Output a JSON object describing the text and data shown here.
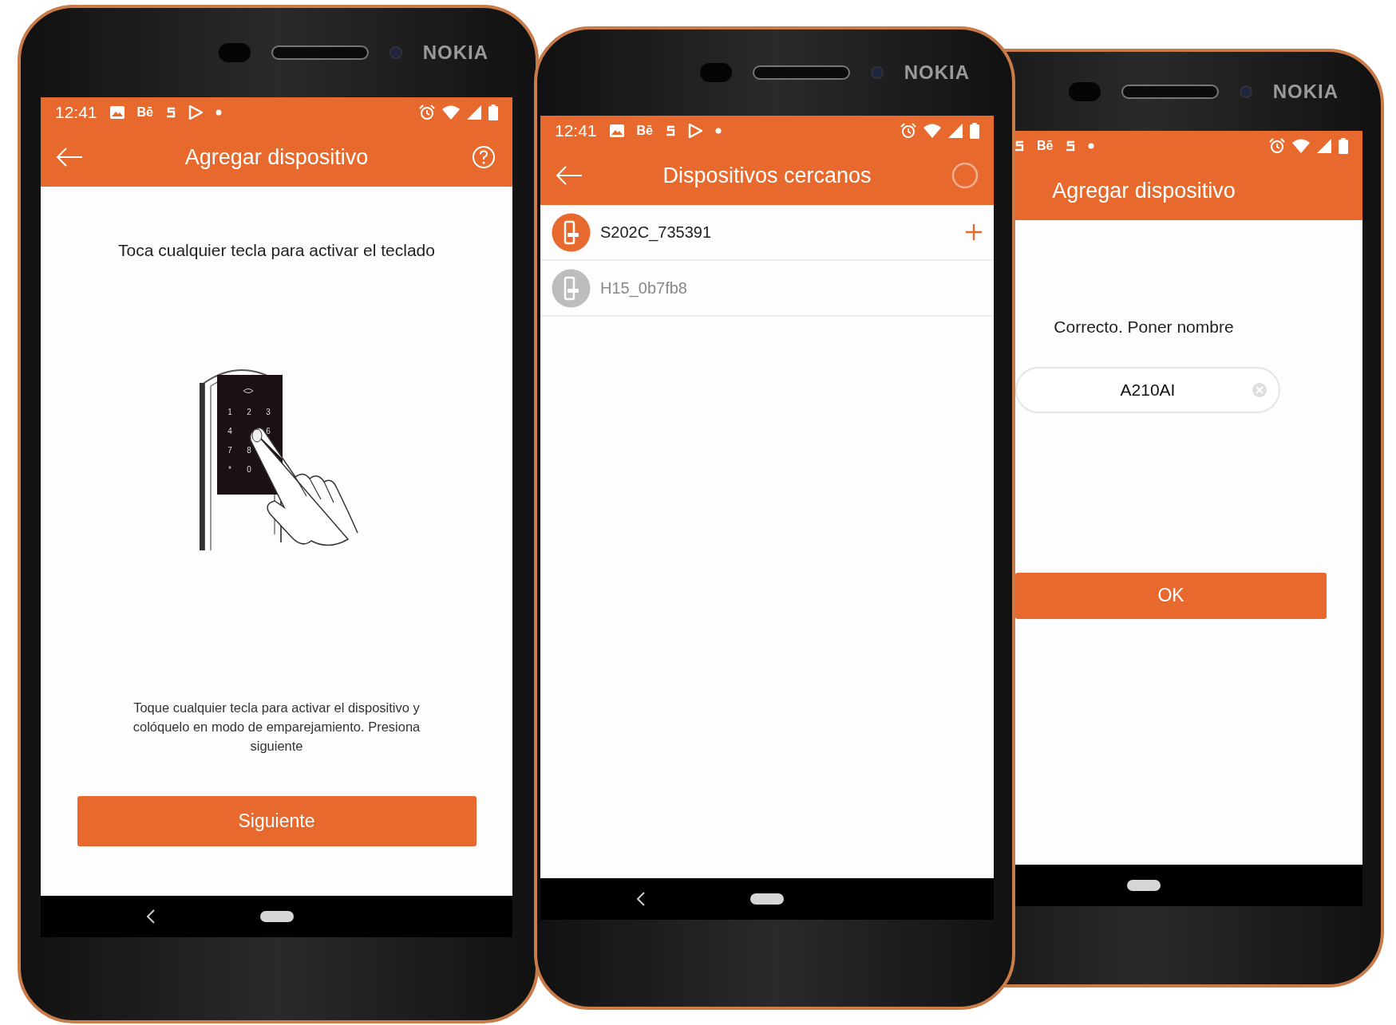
{
  "phones": [
    {
      "brand": "NOKIA",
      "status_bar": [
        {
          "kind": "time",
          "text": "12:41"
        },
        {
          "kind": "image"
        },
        {
          "kind": "text",
          "text": "Bē"
        },
        {
          "kind": "s"
        },
        {
          "kind": "play"
        },
        {
          "kind": "dot"
        }
      ],
      "toolbar": {
        "title": "Agregar dispositivo",
        "back_button": true,
        "help_button": true,
        "loading_indicator": false
      },
      "screen": {
        "kind": "instructions",
        "heading": "Toca cualquier tecla para activar el teclado",
        "keypad_keys": [
          "1",
          "2",
          "3",
          "4",
          "6",
          "7",
          "8",
          "*",
          "0"
        ],
        "description": "Toque cualquier tecla para activar el dispositivo y colóquelo en modo de emparejamiento. Presiona siguiente",
        "button": "Siguiente"
      },
      "nav_back": true
    },
    {
      "brand": "NOKIA",
      "status_bar": [
        {
          "kind": "time",
          "text": "12:41"
        },
        {
          "kind": "image"
        },
        {
          "kind": "text",
          "text": "Bē"
        },
        {
          "kind": "s"
        },
        {
          "kind": "play"
        },
        {
          "kind": "dot"
        }
      ],
      "toolbar": {
        "title": "Dispositivos cercanos",
        "back_button": true,
        "help_button": false,
        "loading_indicator": true
      },
      "screen": {
        "kind": "device_list",
        "rows": [
          {
            "name": "S202C_735391",
            "available": true
          },
          {
            "name": "H15_0b7fb8",
            "available": false
          }
        ]
      },
      "nav_back": true
    },
    {
      "brand": "NOKIA",
      "status_bar": [
        {
          "kind": "s"
        },
        {
          "kind": "text",
          "text": "Bē"
        },
        {
          "kind": "s"
        },
        {
          "kind": "dot"
        }
      ],
      "toolbar": {
        "title": "Agregar dispositivo",
        "back_button": false,
        "help_button": false,
        "loading_indicator": false
      },
      "screen": {
        "kind": "name_device",
        "prompt": "Correcto. Poner nombre",
        "field_value": "A210AI",
        "button": "OK"
      },
      "nav_back": false
    }
  ]
}
